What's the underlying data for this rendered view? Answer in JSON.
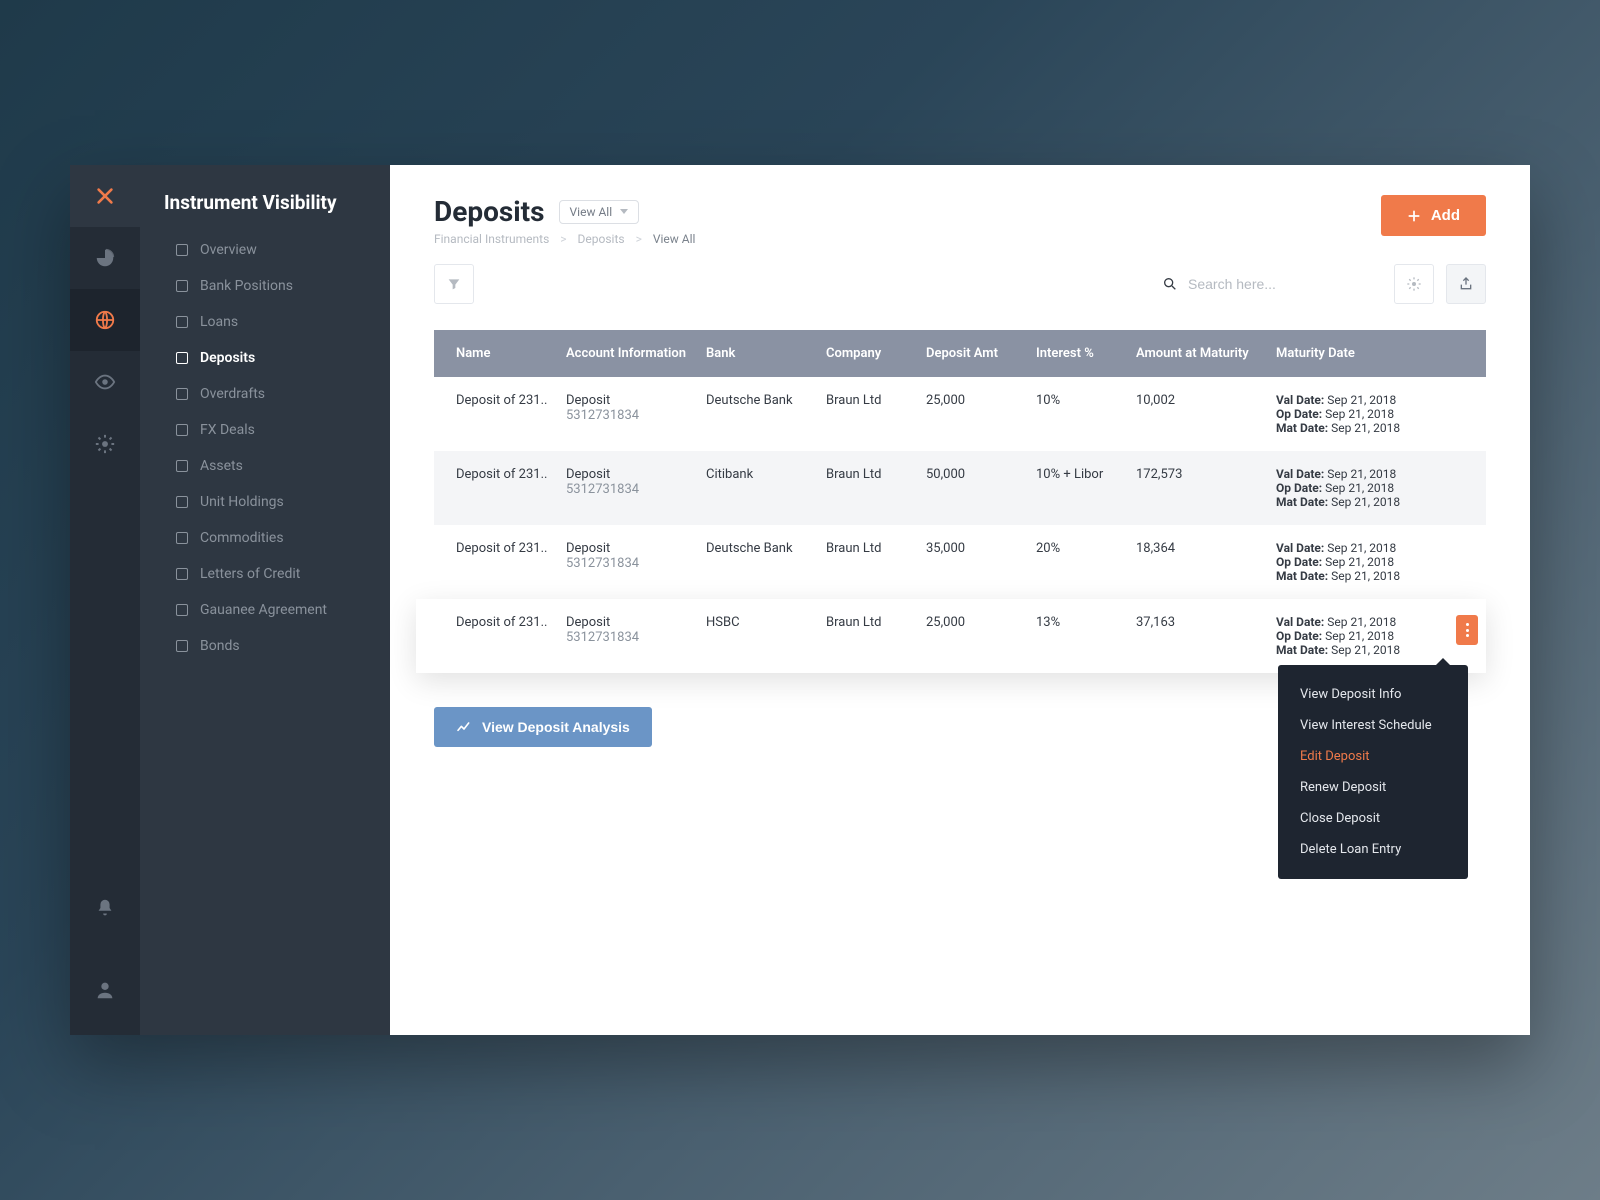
{
  "colors": {
    "accent": "#f07a4a",
    "blue": "#6b95c6",
    "header": "#8a92a3"
  },
  "rail": {
    "items": [
      "pie-chart",
      "globe",
      "eye",
      "gear"
    ],
    "active_index": 1
  },
  "sidebar": {
    "title": "Instrument Visibility",
    "items": [
      {
        "label": "Overview"
      },
      {
        "label": "Bank Positions"
      },
      {
        "label": "Loans"
      },
      {
        "label": "Deposits"
      },
      {
        "label": "Overdrafts"
      },
      {
        "label": "FX Deals"
      },
      {
        "label": "Assets"
      },
      {
        "label": "Unit Holdings"
      },
      {
        "label": "Commodities"
      },
      {
        "label": "Letters of Credit"
      },
      {
        "label": "Gauanee Agreement"
      },
      {
        "label": "Bonds"
      }
    ],
    "active_index": 3
  },
  "page": {
    "title": "Deposits",
    "viewall_chip": "View All"
  },
  "breadcrumb": {
    "items": [
      "Financial Instruments",
      "Deposits",
      "View All"
    ]
  },
  "toolbar": {
    "add": "Add",
    "search_placeholder": "Search here...",
    "analysis": "View Deposit Analysis"
  },
  "table": {
    "columns": [
      "Name",
      "Account Information",
      "Bank",
      "Company",
      "Deposit Amt",
      "Interest %",
      "Amount at Maturity",
      "Maturity Date"
    ],
    "mat_labels": {
      "val": "Val Date:",
      "op": "Op Date:",
      "mat": "Mat Date:"
    },
    "rows": [
      {
        "name": "Deposit of 231..",
        "acc_name": "Deposit",
        "acc_num": "5312731834",
        "bank": "Deutsche Bank",
        "company": "Braun Ltd",
        "amt": "25,000",
        "interest": "10%",
        "maturity_amt": "10,002",
        "val_date": "Sep 21, 2018",
        "op_date": "Sep 21, 2018",
        "mat_date": "Sep 21, 2018"
      },
      {
        "name": "Deposit of 231..",
        "acc_name": "Deposit",
        "acc_num": "5312731834",
        "bank": "Citibank",
        "company": "Braun Ltd",
        "amt": "50,000",
        "interest": "10% + Libor",
        "maturity_amt": "172,573",
        "val_date": "Sep 21, 2018",
        "op_date": "Sep 21, 2018",
        "mat_date": "Sep 21, 2018"
      },
      {
        "name": "Deposit of 231..",
        "acc_name": "Deposit",
        "acc_num": "5312731834",
        "bank": "Deutsche Bank",
        "company": "Braun Ltd",
        "amt": "35,000",
        "interest": "20%",
        "maturity_amt": "18,364",
        "val_date": "Sep 21, 2018",
        "op_date": "Sep 21, 2018",
        "mat_date": "Sep 21, 2018"
      },
      {
        "name": "Deposit of 231..",
        "acc_name": "Deposit",
        "acc_num": "5312731834",
        "bank": "HSBC",
        "company": "Braun Ltd",
        "amt": "25,000",
        "interest": "13%",
        "maturity_amt": "37,163",
        "val_date": "Sep 21, 2018",
        "op_date": "Sep 21, 2018",
        "mat_date": "Sep 21, 2018"
      }
    ],
    "highlight_index": 3
  },
  "context_menu": {
    "items": [
      "View Deposit Info",
      "View Interest Schedule",
      "Edit Deposit",
      "Renew Deposit",
      "Close Deposit",
      "Delete Loan Entry"
    ],
    "active_index": 2
  }
}
